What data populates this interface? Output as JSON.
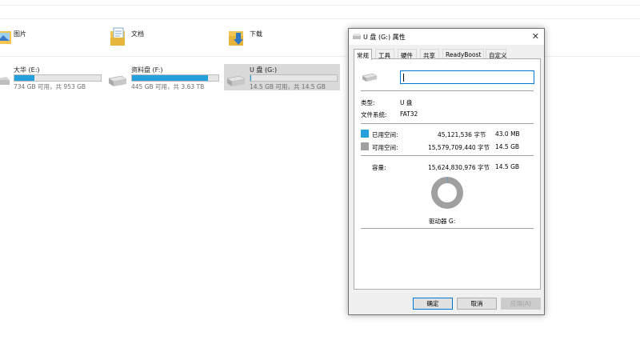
{
  "folders": [
    {
      "label": "图片",
      "icon": "pictures-folder-icon"
    },
    {
      "label": "文档",
      "icon": "documents-folder-icon"
    },
    {
      "label": "下载",
      "icon": "downloads-folder-icon"
    }
  ],
  "drives": [
    {
      "name": "大华 (E:)",
      "info": "734 GB 可用，共 953 GB",
      "used_fraction": 0.23
    },
    {
      "name": "资料盘 (F:)",
      "info": "445 GB 可用，共 3.63 TB",
      "used_fraction": 0.88
    },
    {
      "name": "U 盘 (G:)",
      "info": "14.5 GB 可用，共 14.5 GB",
      "used_fraction": 0.003
    }
  ],
  "dialog": {
    "title": "U 盘 (G:) 属性",
    "tabs": [
      "常规",
      "工具",
      "硬件",
      "共享",
      "ReadyBoost",
      "自定义"
    ],
    "name_value": "",
    "type_label": "类型:",
    "type_value": "U 盘",
    "fs_label": "文件系统:",
    "fs_value": "FAT32",
    "used_label": "已用空间:",
    "used_bytes": "45,121,536 字节",
    "used_size": "43.0 MB",
    "free_label": "可用空间:",
    "free_bytes": "15,579,709,440 字节",
    "free_size": "14.5 GB",
    "capacity_label": "容量:",
    "capacity_bytes": "15,624,830,976 字节",
    "capacity_size": "14.5 GB",
    "drive_label": "驱动器 G:",
    "used_fraction": 0.003,
    "buttons": {
      "ok": "确定",
      "cancel": "取消",
      "apply": "应用(A)"
    }
  },
  "colors": {
    "used": "#26a0da",
    "free": "#a0a0a0",
    "accent": "#0078d7"
  }
}
